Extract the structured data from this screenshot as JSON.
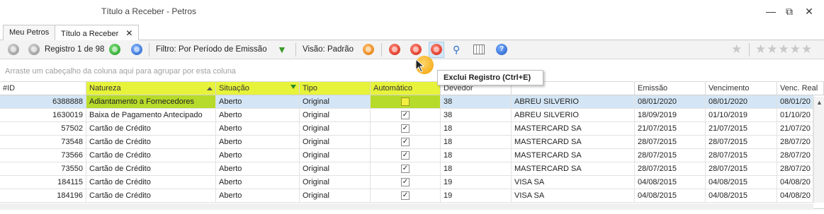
{
  "window": {
    "title": "Título a Receber - Petros",
    "minimize_glyph": "—",
    "restore_glyph": "⧉",
    "close_glyph": "✕"
  },
  "tabs": [
    {
      "label": "Meu Petros",
      "active": false
    },
    {
      "label": "Título a Receber",
      "active": true,
      "close_glyph": "✕"
    }
  ],
  "toolbar": {
    "record_label": "Registro 1 de 98",
    "filter_label": "Filtro: Por Período de Emissão",
    "view_label": "Visão: Padrão",
    "help_glyph": "?",
    "pin_star_glyph": "★",
    "rating_stars": "★★★★★",
    "icons": [
      "first-record-icon",
      "previous-record-icon",
      "next-record-icon",
      "last-record-icon",
      "filter-funnel-icon",
      "view-select-icon",
      "add-record-icon",
      "edit-record-icon",
      "delete-record-icon",
      "search-icon",
      "columns-icon",
      "help-icon"
    ]
  },
  "group_panel": {
    "placeholder": "Arraste um cabeçalho da coluna aqui para agrupar por esta coluna"
  },
  "tooltip": {
    "text": "Exclui Registro (Ctrl+E)"
  },
  "grid": {
    "columns": [
      "#ID",
      "Natureza",
      "Situação",
      "Tipo",
      "Automático",
      "Devedor",
      "",
      "Emissão",
      "Vencimento",
      "Venc. Real"
    ],
    "rows": [
      {
        "id": "6388888",
        "natureza": "Adiantamento a Fornecedores",
        "situacao": "Aberto",
        "tipo": "Original",
        "automatico": "",
        "devedor": "38",
        "nome": "ABREU SILVERIO",
        "emissao": "08/01/2020",
        "vencimento": "08/01/2020",
        "venc_real": "08/01/20"
      },
      {
        "id": "1630019",
        "natureza": "Baixa de Pagamento Antecipado",
        "situacao": "Aberto",
        "tipo": "Original",
        "automatico": "✓",
        "devedor": "38",
        "nome": "ABREU SILVERIO",
        "emissao": "18/09/2019",
        "vencimento": "01/10/2019",
        "venc_real": "01/10/20"
      },
      {
        "id": "57502",
        "natureza": "Cartão de Crédito",
        "situacao": "Aberto",
        "tipo": "Original",
        "automatico": "✓",
        "devedor": "18",
        "nome": "MASTERCARD SA",
        "emissao": "21/07/2015",
        "vencimento": "21/07/2015",
        "venc_real": "21/07/20"
      },
      {
        "id": "73548",
        "natureza": "Cartão de Crédito",
        "situacao": "Aberto",
        "tipo": "Original",
        "automatico": "✓",
        "devedor": "18",
        "nome": "MASTERCARD SA",
        "emissao": "28/07/2015",
        "vencimento": "28/07/2015",
        "venc_real": "28/07/20"
      },
      {
        "id": "73566",
        "natureza": "Cartão de Crédito",
        "situacao": "Aberto",
        "tipo": "Original",
        "automatico": "✓",
        "devedor": "18",
        "nome": "MASTERCARD SA",
        "emissao": "28/07/2015",
        "vencimento": "28/07/2015",
        "venc_real": "28/07/20"
      },
      {
        "id": "73550",
        "natureza": "Cartão de Crédito",
        "situacao": "Aberto",
        "tipo": "Original",
        "automatico": "✓",
        "devedor": "18",
        "nome": "MASTERCARD SA",
        "emissao": "28/07/2015",
        "vencimento": "28/07/2015",
        "venc_real": "28/07/20"
      },
      {
        "id": "184115",
        "natureza": "Cartão de Crédito",
        "situacao": "Aberto",
        "tipo": "Original",
        "automatico": "✓",
        "devedor": "19",
        "nome": "VISA SA",
        "emissao": "04/08/2015",
        "vencimento": "04/08/2015",
        "venc_real": "04/08/20"
      },
      {
        "id": "184196",
        "natureza": "Cartão de Crédito",
        "situacao": "Aberto",
        "tipo": "Original",
        "automatico": "✓",
        "devedor": "19",
        "nome": "VISA SA",
        "emissao": "04/08/2015",
        "vencimento": "04/08/2015",
        "venc_real": "04/08/20"
      }
    ]
  },
  "colors": {
    "highlight_column": "#e6f33a",
    "selected_row": "#d4e6f5",
    "selected_highlight": "#b7db2a",
    "toolbar_bg": "#f3f3f3"
  }
}
